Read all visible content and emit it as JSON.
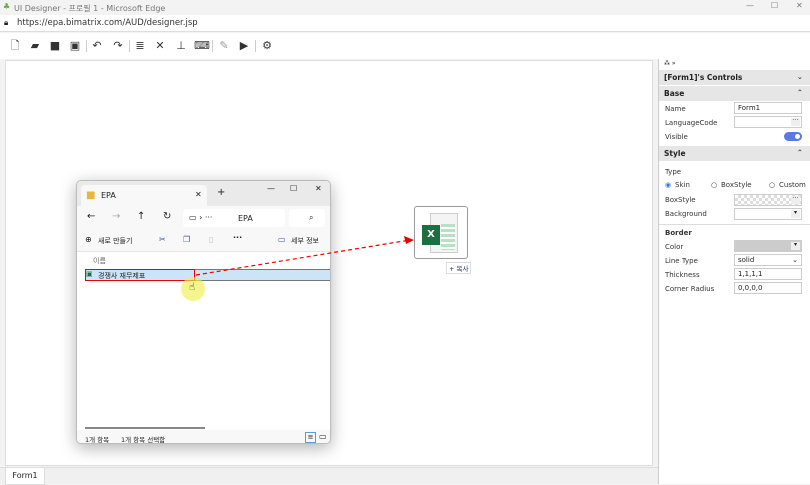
{
  "window": {
    "title": "UI Designer - 프로필 1 - Microsoft Edge",
    "url": "https://epa.bimatrix.com/AUD/designer.jsp"
  },
  "toolbar": {
    "icons": [
      "new-file-icon",
      "open-folder-icon",
      "save-icon",
      "save-all-icon",
      "undo-icon",
      "redo-icon",
      "database-icon",
      "tools-icon",
      "hierarchy-icon",
      "code-icon",
      "edit-icon",
      "run-icon",
      "settings-icon"
    ]
  },
  "bottom": {
    "tab": "Form1"
  },
  "panel": {
    "header_icons": "⁂ »",
    "title": "[Form1]'s Controls",
    "base": {
      "title": "Base",
      "name_label": "Name",
      "name_value": "Form1",
      "language_label": "LanguageCode",
      "language_value": "",
      "visible_label": "Visible",
      "visible": true
    },
    "style": {
      "title": "Style",
      "type_label": "Type",
      "types": [
        "Skin",
        "BoxStyle",
        "Custom"
      ],
      "selected_type": "Skin",
      "boxstyle_label": "BoxStyle",
      "background_label": "Background"
    },
    "border": {
      "title": "Border",
      "color_label": "Color",
      "color_value": "#cccccc",
      "linetype_label": "Line Type",
      "linetype_value": "solid",
      "thickness_label": "Thickness",
      "thickness_value": "1,1,1,1",
      "radius_label": "Corner Radius",
      "radius_value": "0,0,0,0"
    }
  },
  "explorer": {
    "tab": "EPA",
    "path": "EPA",
    "new_label": "새로 만들기",
    "details_label": "세부 정보",
    "column": "이름",
    "file": "경쟁사 재무제표",
    "status_count": "1개 항목",
    "status_selected": "1개 항목 선택함"
  },
  "drag": {
    "copy_label": "+ 복사"
  }
}
